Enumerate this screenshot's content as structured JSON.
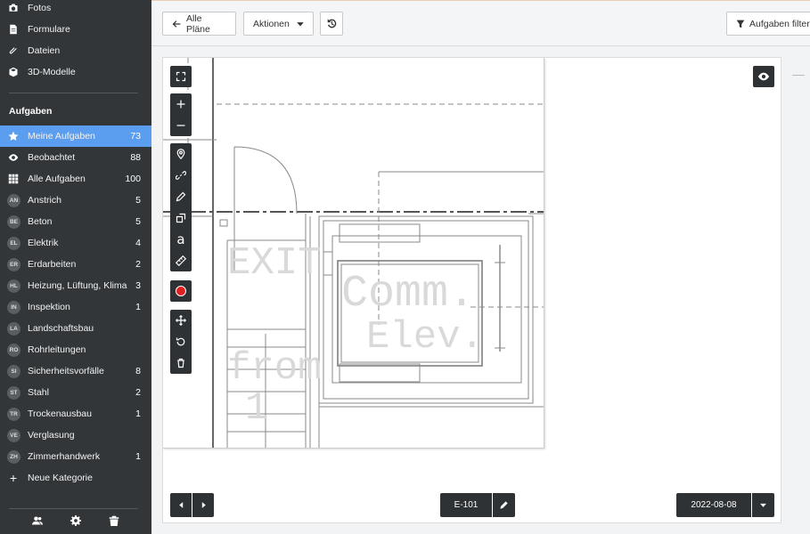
{
  "sidebar": {
    "top_items": [
      {
        "label": "Fotos",
        "icon": "camera-icon"
      },
      {
        "label": "Formulare",
        "icon": "document-icon"
      },
      {
        "label": "Dateien",
        "icon": "paperclip-icon"
      },
      {
        "label": "3D-Modelle",
        "icon": "cube-icon"
      }
    ],
    "section_title": "Aufgaben",
    "task_items": [
      {
        "label": "Meine Aufgaben",
        "count": "73",
        "icon": "star-icon",
        "active": true
      },
      {
        "label": "Beobachtet",
        "count": "88",
        "icon": "eye-icon"
      },
      {
        "label": "Alle Aufgaben",
        "count": "100",
        "icon": "grid-icon"
      }
    ],
    "categories": [
      {
        "badge": "AN",
        "label": "Anstrich",
        "count": "5"
      },
      {
        "badge": "BE",
        "label": "Beton",
        "count": "5"
      },
      {
        "badge": "EL",
        "label": "Elektrik",
        "count": "4"
      },
      {
        "badge": "ER",
        "label": "Erdarbeiten",
        "count": "2"
      },
      {
        "badge": "HL",
        "label": "Heizung, Lüftung, Klima",
        "count": "3"
      },
      {
        "badge": "IN",
        "label": "Inspektion",
        "count": "1"
      },
      {
        "badge": "LA",
        "label": "Landschaftsbau",
        "count": ""
      },
      {
        "badge": "RO",
        "label": "Rohrleitungen",
        "count": ""
      },
      {
        "badge": "SI",
        "label": "Sicherheitsvorfälle",
        "count": "8"
      },
      {
        "badge": "ST",
        "label": "Stahl",
        "count": "2"
      },
      {
        "badge": "TR",
        "label": "Trockenausbau",
        "count": "1"
      },
      {
        "badge": "VE",
        "label": "Verglasung",
        "count": ""
      },
      {
        "badge": "ZH",
        "label": "Zimmerhandwerk",
        "count": "1"
      }
    ],
    "new_category_label": "Neue Kategorie"
  },
  "toolbar": {
    "all_plans_label": "Alle Pläne",
    "actions_label": "Aktionen",
    "filter_label": "Aufgaben filter"
  },
  "plan": {
    "sheet_name": "E-101",
    "date": "2022-08-08",
    "drawing_text": [
      "EXIT",
      "Comm.",
      "Elev.",
      "from",
      "1"
    ]
  },
  "colors": {
    "sidebar_bg": "#333639",
    "active_item": "#5b9ef0",
    "record_dot": "#e02020"
  }
}
